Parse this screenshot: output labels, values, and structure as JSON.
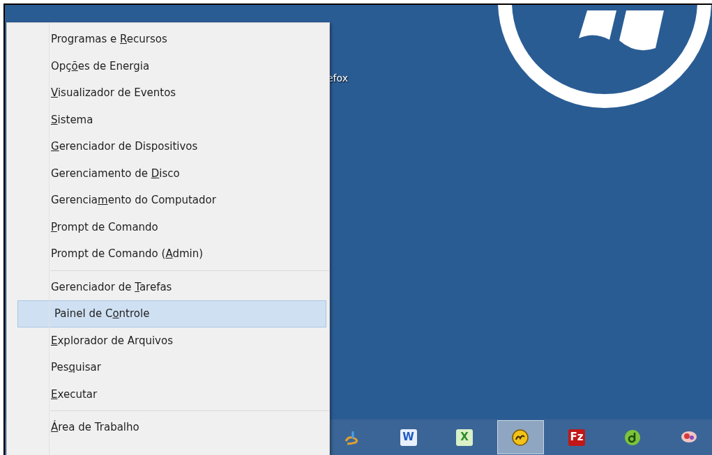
{
  "desktop": {
    "icon_label": "efox"
  },
  "menu": {
    "groups": [
      {
        "items": [
          {
            "pre": "Programas e ",
            "key": "R",
            "post": "ecursos",
            "selected": false
          },
          {
            "pre": "Opç",
            "key": "õ",
            "post": "es de Energia",
            "selected": false
          },
          {
            "key": "V",
            "post": "isualizador de Eventos",
            "selected": false
          },
          {
            "key": "S",
            "post": "istema",
            "selected": false
          },
          {
            "key": "G",
            "post": "erenciador de Dispositivos",
            "selected": false
          },
          {
            "pre": "Gerenciamento de ",
            "key": "D",
            "post": "isco",
            "selected": false
          },
          {
            "pre": "Gerencia",
            "key": "m",
            "post": "ento do Computador",
            "selected": false
          },
          {
            "key": "P",
            "post": "rompt de Comando",
            "selected": false
          },
          {
            "pre": "Prompt de Comando (",
            "key": "A",
            "post": "dmin)",
            "selected": false
          }
        ]
      },
      {
        "items": [
          {
            "pre": "Gerenciador de ",
            "key": "T",
            "post": "arefas",
            "selected": false
          },
          {
            "pre": "Painel de C",
            "key": "o",
            "post": "ntrole",
            "selected": true
          },
          {
            "key": "E",
            "post": "xplorador de Arquivos",
            "selected": false
          },
          {
            "pre": "Pes",
            "key": "q",
            "post": "uisar",
            "selected": false
          },
          {
            "key": "E",
            "post": "xecutar",
            "selected": false
          }
        ]
      },
      {
        "items": [
          {
            "key": "Á",
            "post": "rea de Trabalho",
            "selected": false
          }
        ]
      }
    ]
  },
  "taskbar": {
    "items": [
      {
        "kind": "tool",
        "selected": false
      },
      {
        "kind": "tile",
        "glyph": "W",
        "selected": false
      },
      {
        "kind": "tile",
        "glyph": "X",
        "selected": false
      },
      {
        "kind": "disc",
        "selected": true
      },
      {
        "kind": "tile",
        "glyph": "Fz",
        "selected": false
      },
      {
        "kind": "ring",
        "selected": false
      },
      {
        "kind": "blob",
        "selected": false
      }
    ]
  }
}
